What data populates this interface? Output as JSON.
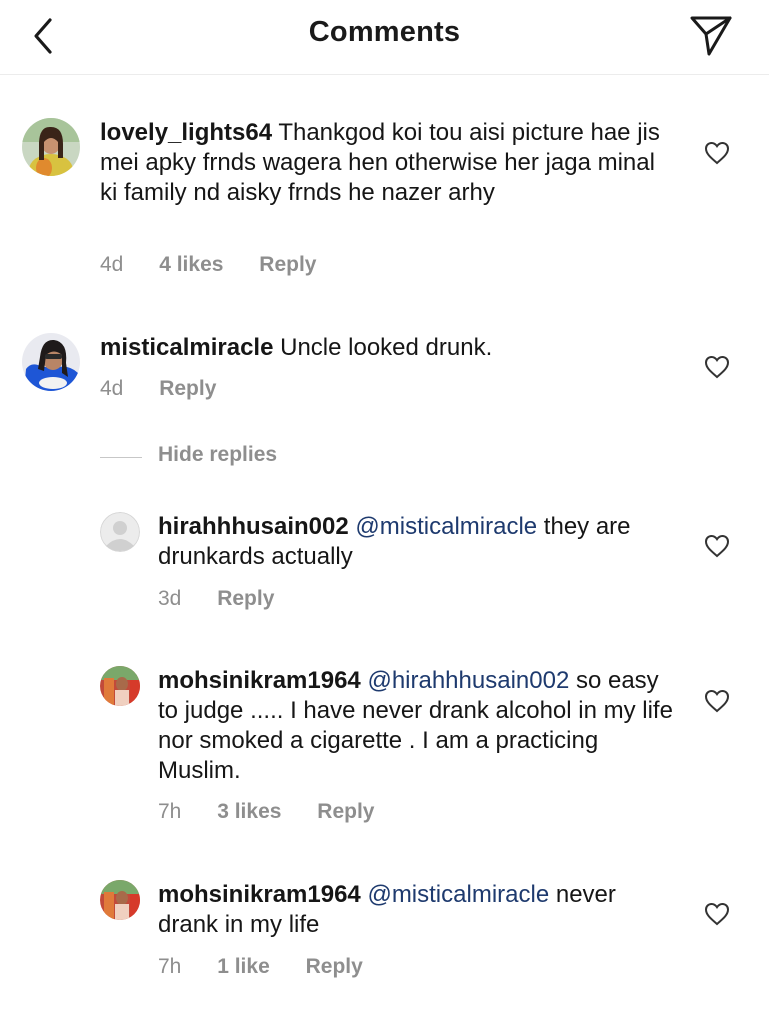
{
  "header": {
    "title": "Comments",
    "back_icon": "chevron-left-icon",
    "send_icon": "paper-plane-icon"
  },
  "comments": [
    {
      "username": "lovely_lights64",
      "text": "Thankgod koi tou aisi picture hae jis mei apky frnds wagera hen otherwise her jaga minal ki family nd aisky frnds he nazer arhy",
      "time": "4d",
      "likes": "4 likes",
      "reply": "Reply"
    },
    {
      "username": "misticalmiracle",
      "text": "Uncle looked drunk.",
      "time": "4d",
      "reply": "Reply",
      "hide_replies": "Hide replies",
      "replies": [
        {
          "username": "hirahhhusain002",
          "mention": "@misticalmiracle",
          "text": "they are drunkards actually",
          "time": "3d",
          "reply": "Reply"
        },
        {
          "username": "mohsinikram1964",
          "mention": "@hirahhhusain002",
          "text": "so easy to judge ..... I have never drank alcohol in my life nor smoked a cigarette . I am a practicing Muslim.",
          "time": "7h",
          "likes": "3 likes",
          "reply": "Reply"
        },
        {
          "username": "mohsinikram1964",
          "mention": "@misticalmiracle",
          "text": "never drank in my life",
          "time": "7h",
          "likes": "1 like",
          "reply": "Reply"
        }
      ]
    }
  ],
  "colors": {
    "text": "#161616",
    "meta": "#8e8e8e",
    "mention": "#1e3a6e",
    "divider": "#ececec"
  }
}
